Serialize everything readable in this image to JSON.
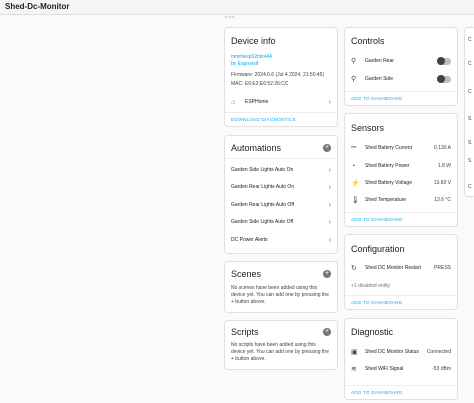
{
  "window": {
    "title": "Shed-Dc-Monitor",
    "breadcrumb": "•• ••••"
  },
  "device_info": {
    "title": "Device info",
    "model": "mmmesp32mini44",
    "maker": "by Espressif",
    "firmware": "Firmware: 2024.6.6 (Jul 4 2024, 21:50:45)",
    "mac": "MAC: E0:E2:E6:52:26:CC",
    "integration": "ESPHome",
    "footer": "DOWNLOAD DIAGNOSTICS"
  },
  "automations": {
    "title": "Automations",
    "items": [
      "Garden Side Lights Auto On",
      "Garden Rear Lights Auto On",
      "Garden Rear Lights Auto Off",
      "Garden Side Lights Auto Off",
      "DC Power Alerts"
    ]
  },
  "scenes": {
    "title": "Scenes",
    "text": "No scenes have been added using this device yet. You can add one by pressing the + button above."
  },
  "scripts": {
    "title": "Scripts",
    "text": "No scripts have been added using this device yet. You can add one by pressing the + button above."
  },
  "controls": {
    "title": "Controls",
    "items": [
      {
        "label": "Garden Rear"
      },
      {
        "label": "Garden Side"
      }
    ],
    "footer": "ADD TO DASHBOARD"
  },
  "sensors": {
    "title": "Sensors",
    "items": [
      {
        "label": "Shed Battery Current",
        "value": "0.130 A",
        "icon": "ammeter-icon"
      },
      {
        "label": "Shed Battery Power",
        "value": "1.8 W",
        "icon": "gauge-icon"
      },
      {
        "label": "Shed Battery Voltage",
        "value": "13.83 V",
        "icon": "flash-icon"
      },
      {
        "label": "Shed Temperature",
        "value": "13.6 °C",
        "icon": "thermometer-icon"
      }
    ],
    "footer": "ADD TO DASHBOARD"
  },
  "configuration": {
    "title": "Configuration",
    "item": "Shed DC Monitor Restart",
    "action": "PRESS",
    "disabled": "+1 disabled entity",
    "footer": "ADD TO DASHBOARD"
  },
  "diagnostic": {
    "title": "Diagnostic",
    "items": [
      {
        "label": "Shed DC Monitor Status",
        "value": "Connected"
      },
      {
        "label": "Shed WiFi Signal",
        "value": "-53 dBm"
      }
    ],
    "footer": "ADD TO DASHBOARD"
  },
  "right_strip": {
    "letters": [
      "C",
      "C",
      "C",
      "S",
      "S",
      "S",
      "C"
    ]
  }
}
